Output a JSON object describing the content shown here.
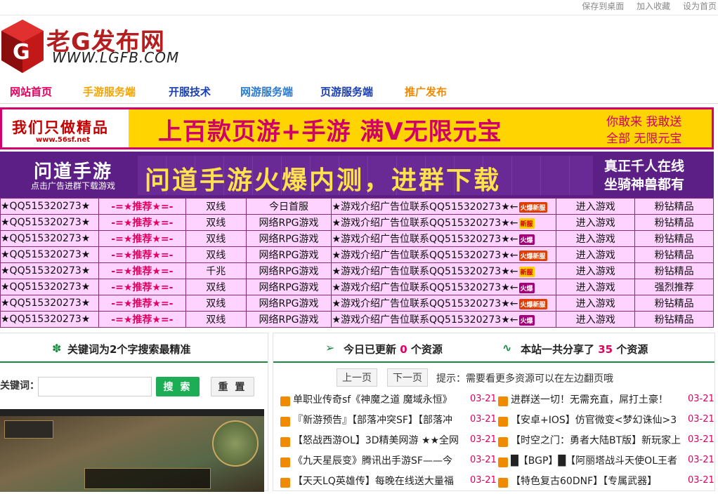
{
  "top_links": [
    "保存到桌面",
    "加入收藏",
    "设为首页"
  ],
  "logo": {
    "name": "老G发布网",
    "url": "WWW.LGFB.COM"
  },
  "nav": [
    {
      "label": "网站首页",
      "color": "#e4005f"
    },
    {
      "label": "手游服务端",
      "color": "#f6a400"
    },
    {
      "label": "开服技术",
      "color": "#1a3fb0"
    },
    {
      "label": "网游服务端",
      "color": "#2a7ad0"
    },
    {
      "label": "页游服务端",
      "color": "#1a3fb0"
    },
    {
      "label": "推广发布",
      "color": "#f08a00"
    }
  ],
  "banner1": {
    "left_title": "我们只做精品",
    "left_url": "www.56sf.net",
    "main": "上百款页游+手游 满V无限元宝",
    "side1": "你敢来 我敢送",
    "side2": "全部 无限元宝"
  },
  "banner2": {
    "left_title": "问道手游",
    "left_sub": "点击广告进群下载游戏",
    "main": "问道手游火爆内测，进群下载",
    "right1": "真正千人在线",
    "right2": "坐骑神兽都有"
  },
  "ads": [
    {
      "c1": "★QQ515320273★",
      "c2": "-=★推荐★=-",
      "c3": "双线",
      "c4": "今日首服",
      "c5": "★游戏介绍广告位联系QQ515320273★←",
      "badge": "火爆新服",
      "bt": "r",
      "c6": "进入游戏",
      "c7": "粉钻精品"
    },
    {
      "c1": "★QQ515320273★",
      "c2": "-=★推荐★=-",
      "c3": "双线",
      "c4": "网络RPG游戏",
      "c5": "★游戏介绍广告位联系QQ515320273★←",
      "badge": "新服",
      "bt": "y",
      "c6": "进入游戏",
      "c7": "粉钻精品"
    },
    {
      "c1": "★QQ515320273★",
      "c2": "-=★推荐★=-",
      "c3": "双线",
      "c4": "网络RPG游戏",
      "c5": "★游戏介绍广告位联系QQ515320273★←",
      "badge": "火爆",
      "bt": "p",
      "c6": "进入游戏",
      "c7": "粉钻精品"
    },
    {
      "c1": "★QQ515320273★",
      "c2": "-=★推荐★=-",
      "c3": "双线",
      "c4": "网络RPG游戏",
      "c5": "★游戏介绍广告位联系QQ515320273★←",
      "badge": "火爆新服",
      "bt": "r",
      "c6": "进入游戏",
      "c7": "粉钻精品"
    },
    {
      "c1": "★QQ515320273★",
      "c2": "-=★推荐★=-",
      "c3": "千兆",
      "c4": "网络RPG游戏",
      "c5": "★游戏介绍广告位联系QQ515320273★←",
      "badge": "新服",
      "bt": "y",
      "c6": "进入游戏",
      "c7": "粉钻精品"
    },
    {
      "c1": "★QQ515320273★",
      "c2": "-=★推荐★=-",
      "c3": "双线",
      "c4": "网络RPG游戏",
      "c5": "★游戏介绍广告位联系QQ515320273★←",
      "badge": "火爆",
      "bt": "p",
      "c6": "进入游戏",
      "c7": "强烈推荐"
    },
    {
      "c1": "★QQ515320273★",
      "c2": "-=★推荐★=-",
      "c3": "双线",
      "c4": "网络RPG游戏",
      "c5": "★游戏介绍广告位联系QQ515320273★←",
      "badge": "火爆新服",
      "bt": "r",
      "c6": "进入游戏",
      "c7": "粉钻精品"
    },
    {
      "c1": "★QQ515320273★",
      "c2": "-=★推荐★=-",
      "c3": "双线",
      "c4": "网络RPG游戏",
      "c5": "★游戏介绍广告位联系QQ515320273★←",
      "badge": "火爆",
      "bt": "p",
      "c6": "进入游戏",
      "c7": "粉钻精品"
    }
  ],
  "search": {
    "heading": "关键词为2个字搜索最精准",
    "label": "关键词：",
    "placeholder": "",
    "search_btn": "搜 索",
    "reset_btn": "重 置"
  },
  "updates": {
    "today_prefix": "今日已更新",
    "today_count": "0",
    "today_suffix": "个资源",
    "total_prefix": "本站一共分享了",
    "total_count": "35",
    "total_suffix": "个资源",
    "prev": "上一页",
    "next": "下一页",
    "tip": "提示：需要看更多资源可以在左边翻页哦"
  },
  "news_left": [
    {
      "title": "单职业传奇sf《神魔之道 魔域永恒》",
      "date": "03-21"
    },
    {
      "title": "『新游预告』【部落冲突SF】【部落冲",
      "date": "03-21"
    },
    {
      "title": "【怒战西游OL】3D精美网游 ★★全网",
      "date": "03-21"
    },
    {
      "title": "《九天星辰变》腾讯出手游SF——今",
      "date": "03-21"
    },
    {
      "title": "【天天LQ英雄传】每晚在线送大量福",
      "date": "03-21"
    }
  ],
  "news_right": [
    {
      "title": "进群送一切！无需充直，屌打土豪！",
      "date": "03-21"
    },
    {
      "title": "【安卓+IOS】仿官微变<梦幻诛仙>3",
      "date": "03-21"
    },
    {
      "title": "【时空之门：勇者大陆BT版】新玩家上",
      "date": "03-21"
    },
    {
      "title": "█【BGP】█【阿丽塔战斗天使OL王者",
      "date": "03-21"
    },
    {
      "title": "【特色复古60DNF】【专属武器】",
      "date": "03-21"
    }
  ]
}
